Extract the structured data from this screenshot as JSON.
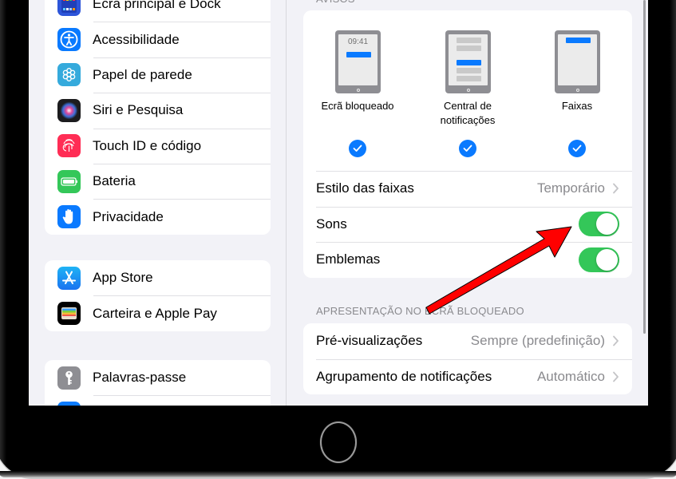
{
  "sidebar": {
    "groups": [
      {
        "items": [
          {
            "label": "Ecrã principal e Dock",
            "icon": "home-screen-icon",
            "color": "#2d55d9"
          },
          {
            "label": "Acessibilidade",
            "icon": "accessibility-icon",
            "color": "#0a7aff"
          },
          {
            "label": "Papel de parede",
            "icon": "wallpaper-icon",
            "color": "#35aadc"
          },
          {
            "label": "Siri e Pesquisa",
            "icon": "siri-icon",
            "color": "#222222"
          },
          {
            "label": "Touch ID e código",
            "icon": "fingerprint-icon",
            "color": "#ff2d55"
          },
          {
            "label": "Bateria",
            "icon": "battery-icon",
            "color": "#34c759"
          },
          {
            "label": "Privacidade",
            "icon": "hand-icon",
            "color": "#0a7aff"
          }
        ]
      },
      {
        "items": [
          {
            "label": "App Store",
            "icon": "app-store-icon",
            "color": "#1e90ff"
          },
          {
            "label": "Carteira e Apple Pay",
            "icon": "wallet-icon",
            "color": "#000000"
          }
        ]
      },
      {
        "items": [
          {
            "label": "Palavras-passe",
            "icon": "key-icon",
            "color": "#8e8e93"
          },
          {
            "label": "",
            "icon": "mail-icon",
            "color": "#0a7aff"
          }
        ]
      }
    ]
  },
  "detail": {
    "alerts_header": "AVISOS",
    "alert_styles": [
      {
        "caption": "Ecrã bloqueado",
        "clock": "09:41",
        "checked": true
      },
      {
        "caption": "Central de notificações",
        "checked": true
      },
      {
        "caption": "Faixas",
        "checked": true
      }
    ],
    "banner_style": {
      "label": "Estilo das faixas",
      "value": "Temporário"
    },
    "sounds": {
      "label": "Sons",
      "on": true
    },
    "badges": {
      "label": "Emblemas",
      "on": true
    },
    "lock_screen_header": "APRESENTAÇÃO NO ECRÃ BLOQUEADO",
    "previews": {
      "label": "Pré-visualizações",
      "value": "Sempre (predefinição)"
    },
    "grouping": {
      "label": "Agrupamento de notificações",
      "value": "Automático"
    }
  },
  "colors": {
    "accent": "#0a7aff",
    "toggle_on": "#34c759",
    "annotation_arrow": "#ff0000"
  },
  "annotation": {
    "type": "arrow",
    "points_to": "sounds-toggle"
  }
}
